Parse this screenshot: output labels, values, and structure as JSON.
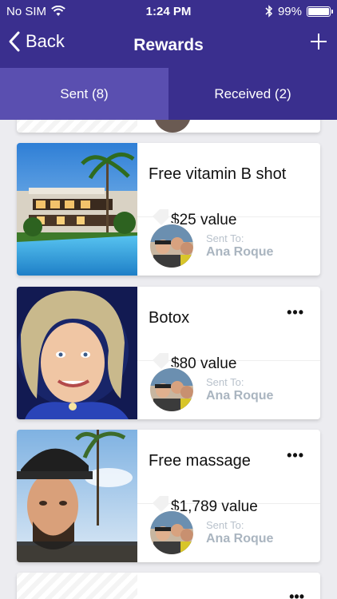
{
  "status": {
    "carrier": "No SIM",
    "time": "1:24 PM",
    "battery": "99%",
    "battery_level": 0.99
  },
  "nav": {
    "back_label": "Back",
    "title": "Rewards"
  },
  "tabs": [
    {
      "label": "Sent (8)",
      "active": true
    },
    {
      "label": "Received (2)",
      "active": false
    }
  ],
  "rewards": [
    {
      "name": "Free vitamin B shot",
      "value": "$25 value",
      "sent_label": "Sent To:",
      "recipient": "Ana Roque",
      "image": "luxury-villa-pool-photo"
    },
    {
      "name": "Botox",
      "value": "$80 value",
      "sent_label": "Sent To:",
      "recipient": "Ana Roque",
      "image": "portrait-illustration"
    },
    {
      "name": "Free massage",
      "value": "$1,789 value",
      "sent_label": "Sent To:",
      "recipient": "Ana Roque",
      "image": "man-beach-selfie"
    }
  ],
  "colors": {
    "nav_bg": "#3a2f8e",
    "tab_active": "#5a4fb0",
    "muted_text": "#aab5c0"
  }
}
